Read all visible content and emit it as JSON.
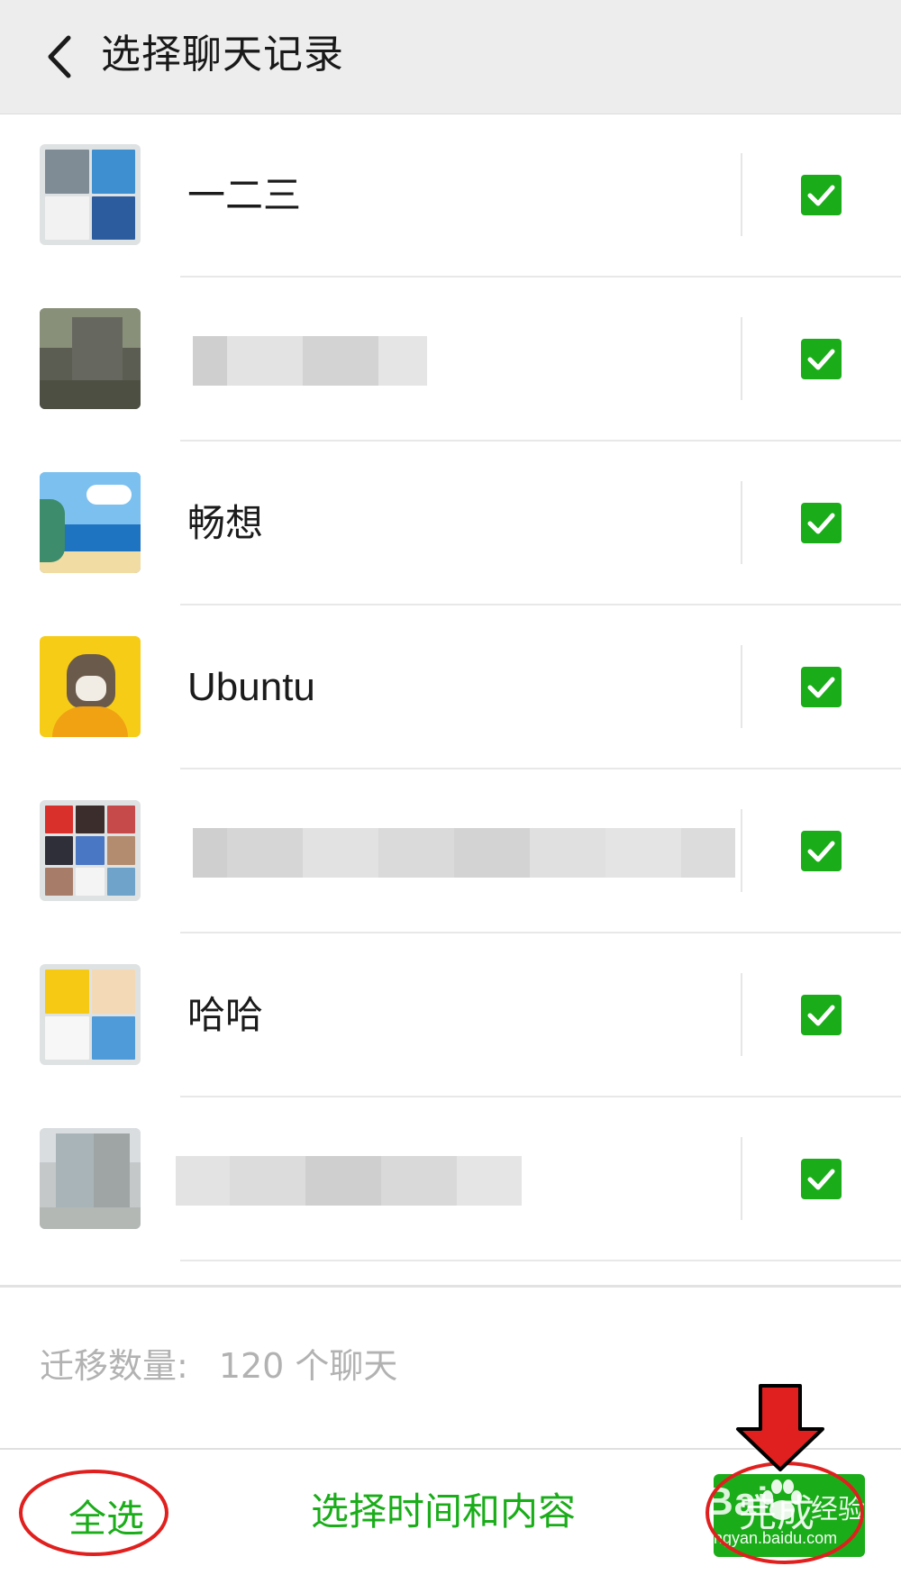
{
  "header": {
    "back_icon": "chevron-left-icon",
    "title": "选择聊天记录"
  },
  "chats": [
    {
      "name": "一二三",
      "name_visible": true,
      "selected": true,
      "avatar": "group-collage"
    },
    {
      "name": "",
      "name_visible": false,
      "selected": true,
      "avatar": "photo-blurred"
    },
    {
      "name": "畅想",
      "name_visible": true,
      "selected": true,
      "avatar": "cartoon-seaside"
    },
    {
      "name": "Ubuntu",
      "name_visible": true,
      "selected": true,
      "avatar": "dog-yellow"
    },
    {
      "name": "",
      "name_visible": false,
      "selected": true,
      "avatar": "group-collage-9"
    },
    {
      "name": "哈哈",
      "name_visible": true,
      "selected": true,
      "avatar": "group-collage-4"
    },
    {
      "name": "",
      "name_visible": false,
      "selected": true,
      "avatar": "photo-blurred"
    }
  ],
  "summary": {
    "label": "迁移数量:",
    "count": "120 个聊天"
  },
  "footer": {
    "select_all": "全选",
    "select_time": "选择时间和内容",
    "done": "完成"
  },
  "watermark": {
    "brand": "Bai",
    "site": "jingyan.baidu.com",
    "sub": "经验"
  },
  "colors": {
    "accent": "#1aad19",
    "annotation": "#e0201e",
    "header_bg": "#ededed",
    "secondary_text": "#b2b2b2"
  }
}
